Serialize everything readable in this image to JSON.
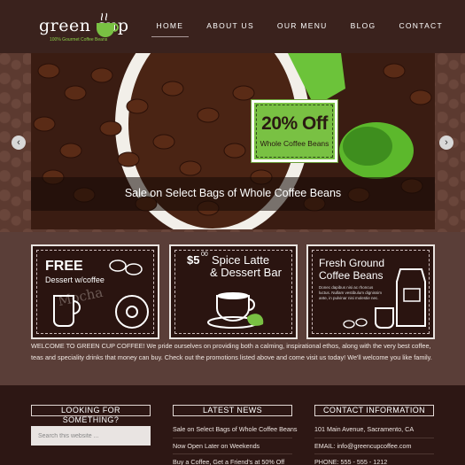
{
  "header": {
    "logo_text": "green cup",
    "logo_tagline": "100% Gourmet Coffee Beans",
    "nav": [
      "HOME",
      "ABOUT US",
      "OUR MENU",
      "BLOG",
      "CONTACT"
    ]
  },
  "slider": {
    "promo_big": "20% Off",
    "promo_small": "Whole Coffee Beans",
    "caption": "Sale on Select Bags of Whole Coffee Beans",
    "prev_icon": "chevron-left-icon",
    "next_icon": "chevron-right-icon"
  },
  "cards": {
    "card1": {
      "line1": "FREE",
      "line2": "Dessert w/coffee",
      "watermark": "Mocha"
    },
    "card2": {
      "sup": "$5",
      "sup_cents": "00",
      "line1": "Spice Latte",
      "line2": "& Dessert Bar"
    },
    "card3": {
      "line1": "Fresh Ground",
      "line2": "Coffee Beans",
      "small": "Donec dapibus nisi ac rhoncus luctus. Nullam vestibulum dignissim ante, in pulvinar nisi molestie nec."
    }
  },
  "welcome": "WELCOME TO GREEN CUP COFFEE! We pride ourselves on providing both a calming, inspirational ethos, along with the very best coffee, teas and speciality drinks that money can buy. Check out the promotions listed above and come visit us today! We'll welcome you like family.",
  "footer": {
    "search_title": "LOOKING FOR SOMETHING?",
    "search_placeholder": "Search this website ...",
    "news_title": "LATEST NEWS",
    "news": [
      "Sale on Select Bags of Whole Coffee Beans",
      "Now Open Later on Weekends",
      "Buy a Coffee, Get a Friend's at 50% Off"
    ],
    "contact_title": "CONTACT INFORMATION",
    "contact": [
      "101 Main Avenue, Sacramento, CA",
      "EMAIL: info@greencupcoffee.com",
      "PHONE: 555 - 555 - 1212"
    ]
  },
  "colors": {
    "header_bg": "#3a221d",
    "page_bg": "#5a3e38",
    "accent_green": "#79c143",
    "footer_bg": "#2d1714"
  }
}
